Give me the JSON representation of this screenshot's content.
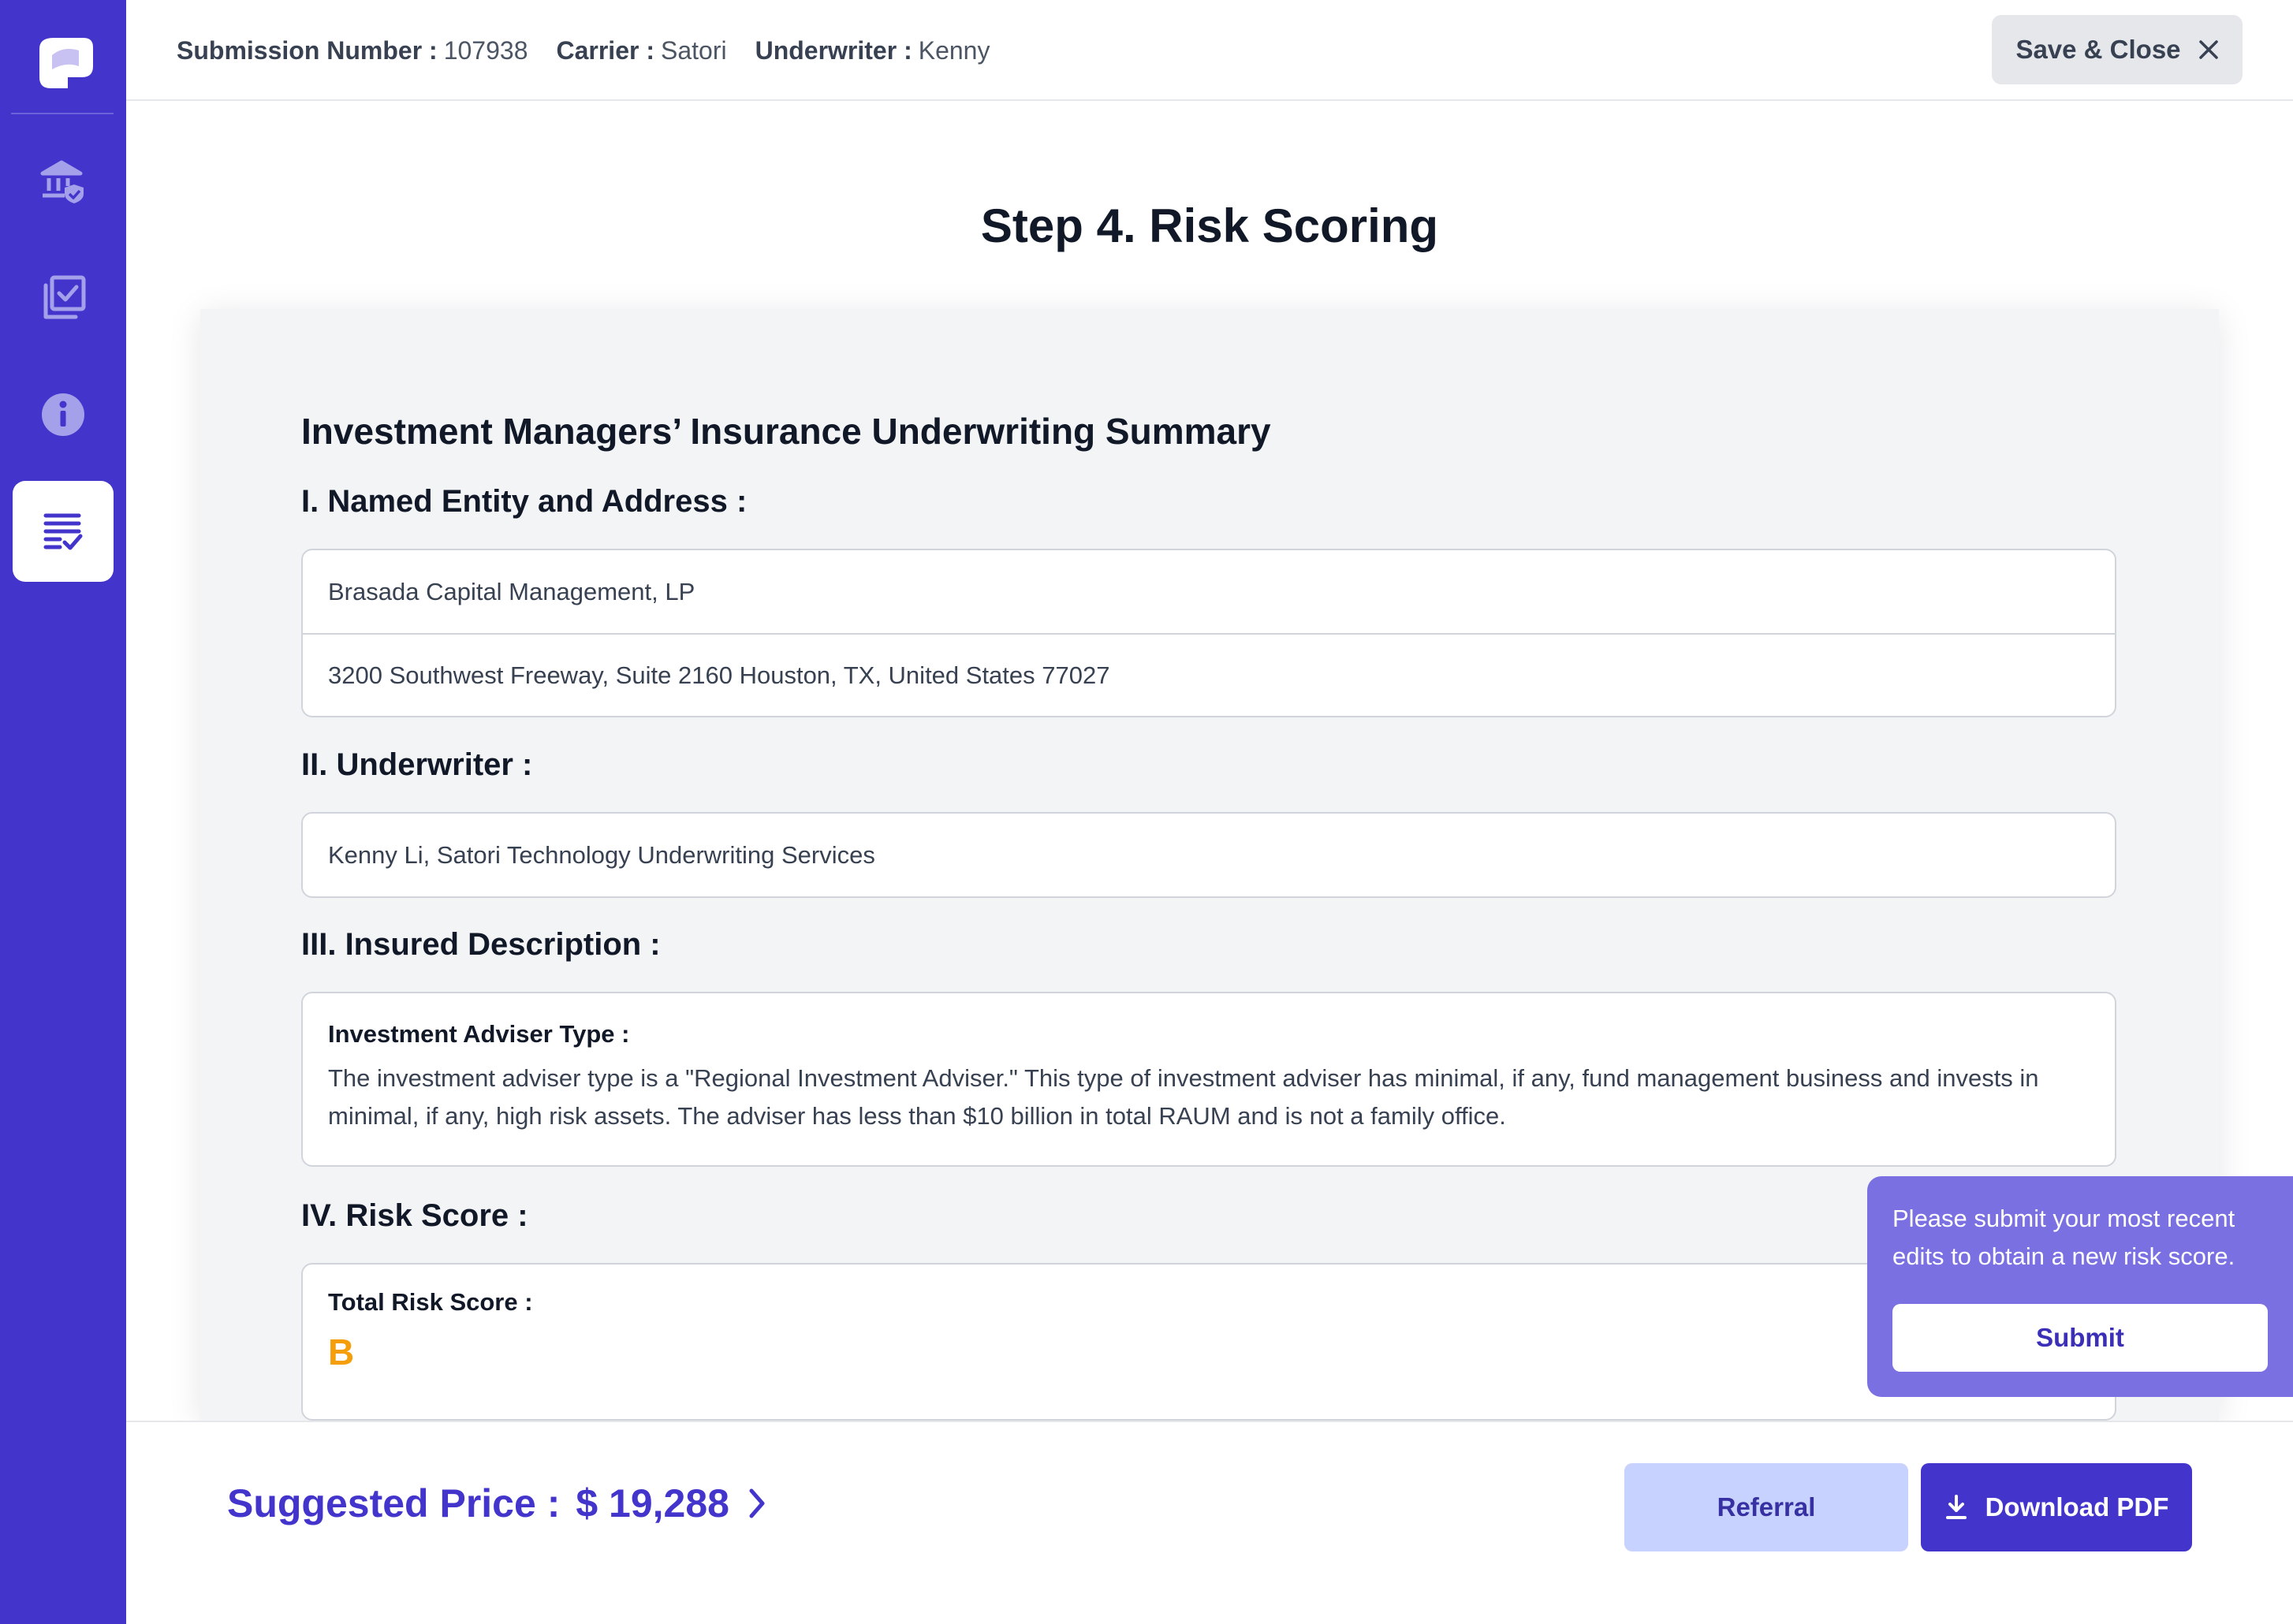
{
  "header": {
    "submission_label": "Submission Number :",
    "submission_value": "107938",
    "carrier_label": "Carrier :",
    "carrier_value": "Satori",
    "underwriter_label": "Underwriter :",
    "underwriter_value": "Kenny",
    "save_close_label": "Save & Close"
  },
  "sidebar": {
    "items": [
      {
        "icon": "bank-shield-icon",
        "active": false
      },
      {
        "icon": "checklist-copy-icon",
        "active": false
      },
      {
        "icon": "info-icon",
        "active": false
      },
      {
        "icon": "document-check-icon",
        "active": true
      }
    ]
  },
  "page": {
    "title": "Step 4. Risk Scoring"
  },
  "summary": {
    "title": "Investment Managers’ Insurance Underwriting Summary",
    "section1": {
      "heading": "I. Named Entity and Address :",
      "entity": "Brasada Capital Management, LP",
      "address": "3200 Southwest Freeway, Suite 2160 Houston, TX, United States 77027"
    },
    "section2": {
      "heading": "II. Underwriter :",
      "value": "Kenny Li, Satori Technology Underwriting Services"
    },
    "section3": {
      "heading": "III. Insured Description :",
      "label": "Investment Adviser Type :",
      "text": "The investment adviser type is a \"Regional Investment Adviser.\" This type of investment adviser has minimal, if any, fund management business and invests in minimal, if any, high risk assets. The adviser has less than $10 billion in total RAUM and is not a family office."
    },
    "section4": {
      "heading": "IV. Risk Score :",
      "label": "Total Risk Score :",
      "grade": "B"
    }
  },
  "popover": {
    "text": "Please submit your most recent edits to obtain a new risk score.",
    "submit_label": "Submit"
  },
  "footer": {
    "price_label": "Suggested Price :",
    "price_value": "$ 19,288",
    "referral_label": "Referral",
    "download_label": "Download PDF"
  },
  "colors": {
    "brand": "#4335cc",
    "grade": "#f59e0b",
    "popover": "#7b70e2",
    "referral_bg": "#c7d2fe"
  }
}
